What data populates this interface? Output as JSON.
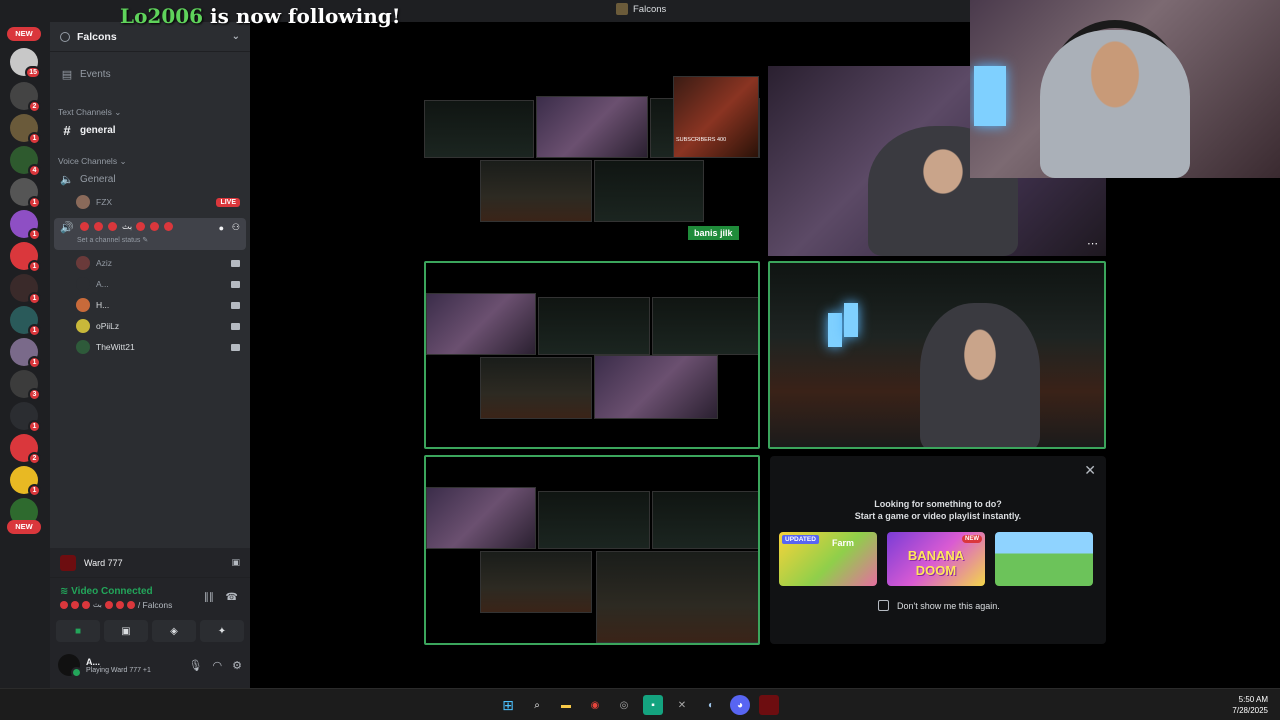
{
  "window": {
    "title": "Falcons"
  },
  "follow_alert": {
    "username": "Lo2006",
    "text": " is now following!"
  },
  "rail": {
    "top_pill": "NEW",
    "bottom_pill": "NEW",
    "badges": [
      "15",
      "2",
      "1",
      "4",
      "1",
      "1",
      "1",
      "1",
      "1",
      "1",
      "3",
      "1",
      "2",
      "1"
    ]
  },
  "server": {
    "name": "Falcons"
  },
  "channels": {
    "events": "Events",
    "text_category": "Text Channels",
    "general_text": "general",
    "voice_category": "Voice Channels",
    "general_voice": "General",
    "live_user": "FZX",
    "live_badge": "LIVE",
    "active_voice_suffix": "بث",
    "channel_status": "Set a channel status",
    "voice_users": [
      "Aziz",
      "A...",
      "H...",
      "oPiiLz",
      "TheWitt21"
    ]
  },
  "user_panel": {
    "activity_name": "Ward 777",
    "voice_status": "Video Connected",
    "voice_location": "/ Falcons",
    "voice_channel_suffix": "بث",
    "username": "A...",
    "user_status": "Playing Ward 777 +1"
  },
  "stage": {
    "sticker_text": "banis jilk",
    "mini_caption": "SUBSCRIBERS 400",
    "activity_prompt_line1": "Looking for something to do?",
    "activity_prompt_line2": "Start a game or video playlist instantly.",
    "games": [
      {
        "name": "Farm",
        "tag": "UPDATED"
      },
      {
        "name": "BANANA DOOM",
        "tag": "NEW"
      },
      {
        "name": "",
        "tag": ""
      }
    ],
    "dont_show": "Don't show me this again."
  },
  "taskbar": {
    "time": "5:50 AM",
    "date": "7/28/2025"
  },
  "colors": {
    "speaking": "#3ba55c",
    "accent_red": "#da373c",
    "connected": "#23a55a"
  }
}
